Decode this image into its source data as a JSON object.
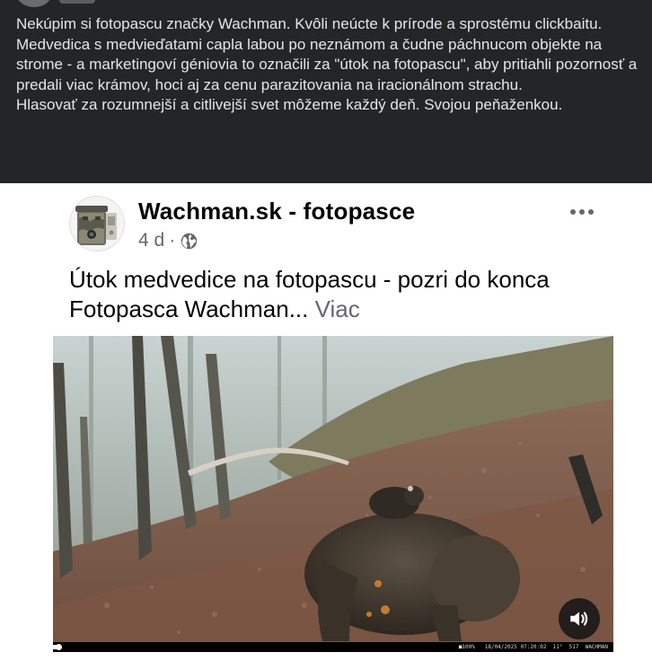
{
  "post": {
    "paragraphs": [
      "Nekúpim si fotopascu značky Wachman. Kvôli neúcte k prírode a sprostému clickbaitu.",
      "Medvedica s medvieďatami capla labou po neznámom a čudne páchnucom objekte na strome - a marketingoví géniovia to označili za \"útok na fotopascu\", aby pritiahli pozornosť a predali viac krámov, hoci aj za cenu parazitovania na iracionálnom strachu.",
      "Hlasovať za rozumnejší a citlivejší svet môžeme každý deň. Svojou peňaženkou."
    ]
  },
  "shared": {
    "page_name": "Wachman.sk - fotopasce",
    "time": "4 d",
    "separator": "·",
    "caption": "Útok medvedice na fotopascu - pozri do konca Fotopasca Wachman...",
    "see_more": "Viac"
  },
  "video": {
    "progress_fraction": 0.01,
    "stamp": "■100%   18/04/2025 07:20:02  11°  517  WACHMAN"
  },
  "icons": {
    "more": "more-horizontal-icon",
    "globe": "globe-icon",
    "sound": "speaker-icon",
    "avatar": "camera-trap-avatar"
  },
  "colors": {
    "dark_bg": "#242526",
    "dark_text": "#e4e6eb",
    "secondary_text": "#65676b",
    "primary_text": "#050505"
  }
}
